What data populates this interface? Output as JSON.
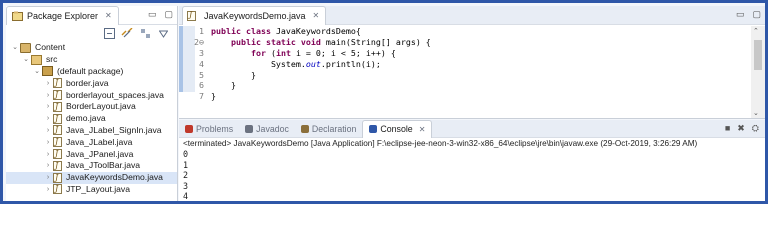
{
  "explorer": {
    "tab_label": "Package Explorer",
    "tab_close": "✕",
    "win_min": "▭",
    "win_max": "▢",
    "tree": [
      {
        "label": "Content",
        "depth": 0,
        "twisty": "⌄",
        "icon": "project"
      },
      {
        "label": "src",
        "depth": 1,
        "twisty": "⌄",
        "icon": "src"
      },
      {
        "label": "(default package)",
        "depth": 2,
        "twisty": "⌄",
        "icon": "pkg"
      },
      {
        "label": "border.java",
        "depth": 3,
        "twisty": "›",
        "icon": "file"
      },
      {
        "label": "borderlayout_spaces.java",
        "depth": 3,
        "twisty": "›",
        "icon": "file"
      },
      {
        "label": "BorderLayout.java",
        "depth": 3,
        "twisty": "›",
        "icon": "file"
      },
      {
        "label": "demo.java",
        "depth": 3,
        "twisty": "›",
        "icon": "file"
      },
      {
        "label": "Java_JLabel_SignIn.java",
        "depth": 3,
        "twisty": "›",
        "icon": "file"
      },
      {
        "label": "Java_JLabel.java",
        "depth": 3,
        "twisty": "›",
        "icon": "file"
      },
      {
        "label": "Java_JPanel.java",
        "depth": 3,
        "twisty": "›",
        "icon": "file"
      },
      {
        "label": "Java_JToolBar.java",
        "depth": 3,
        "twisty": "›",
        "icon": "file"
      },
      {
        "label": "JavaKeywordsDemo.java",
        "depth": 3,
        "twisty": "›",
        "icon": "file",
        "selected": true
      },
      {
        "label": "JTP_Layout.java",
        "depth": 3,
        "twisty": "›",
        "icon": "file"
      }
    ]
  },
  "editor": {
    "tab_label": "JavaKeywordsDemo.java",
    "tab_close": "✕",
    "win_min": "▭",
    "win_max": "▢",
    "lines": [
      {
        "n": "1",
        "html_parts": [
          [
            "kw",
            "public class "
          ],
          [
            "t",
            "JavaKeywordsDemo{"
          ]
        ]
      },
      {
        "n": "2⊖",
        "html_parts": [
          [
            "t",
            "    "
          ],
          [
            "kw",
            "public static void "
          ],
          [
            "t",
            "main(String[] args) {"
          ]
        ]
      },
      {
        "n": "3",
        "html_parts": [
          [
            "t",
            "        "
          ],
          [
            "kw",
            "for "
          ],
          [
            "t",
            "("
          ],
          [
            "kw",
            "int "
          ],
          [
            "t",
            "i = 0; i < 5; i++) {"
          ]
        ]
      },
      {
        "n": "4",
        "html_parts": [
          [
            "t",
            "            System."
          ],
          [
            "it",
            "out"
          ],
          [
            "t",
            ".println(i);"
          ]
        ]
      },
      {
        "n": "5",
        "html_parts": [
          [
            "t",
            "        }"
          ]
        ]
      },
      {
        "n": "6",
        "html_parts": [
          [
            "t",
            "    }"
          ]
        ]
      },
      {
        "n": "7",
        "html_parts": [
          [
            "t",
            "}"
          ]
        ]
      }
    ]
  },
  "console": {
    "tabs": [
      {
        "label": "Problems",
        "icon": "problems-icon",
        "color": "#c0392b",
        "active": false
      },
      {
        "label": "Javadoc",
        "icon": "javadoc-icon",
        "color": "#6b7280",
        "active": false
      },
      {
        "label": "Declaration",
        "icon": "declaration-icon",
        "color": "#8b6f3a",
        "active": false
      },
      {
        "label": "Console",
        "icon": "console-icon",
        "color": "#2f57a8",
        "active": true
      }
    ],
    "active_close": "✕",
    "status": "<terminated> JavaKeywordsDemo [Java Application] F:\\eclipse-jee-neon-3-win32-x86_64\\eclipse\\jre\\bin\\javaw.exe (29-Oct-2019, 3:26:29 AM)",
    "output": [
      "0",
      "1",
      "2",
      "3",
      "4"
    ],
    "tools": {
      "stop": "■",
      "remove": "✖",
      "clear": "⛭"
    }
  },
  "colors": {
    "frame": "#2f57a8",
    "keyword": "#7f0055",
    "selection": "#d9e5f7"
  }
}
